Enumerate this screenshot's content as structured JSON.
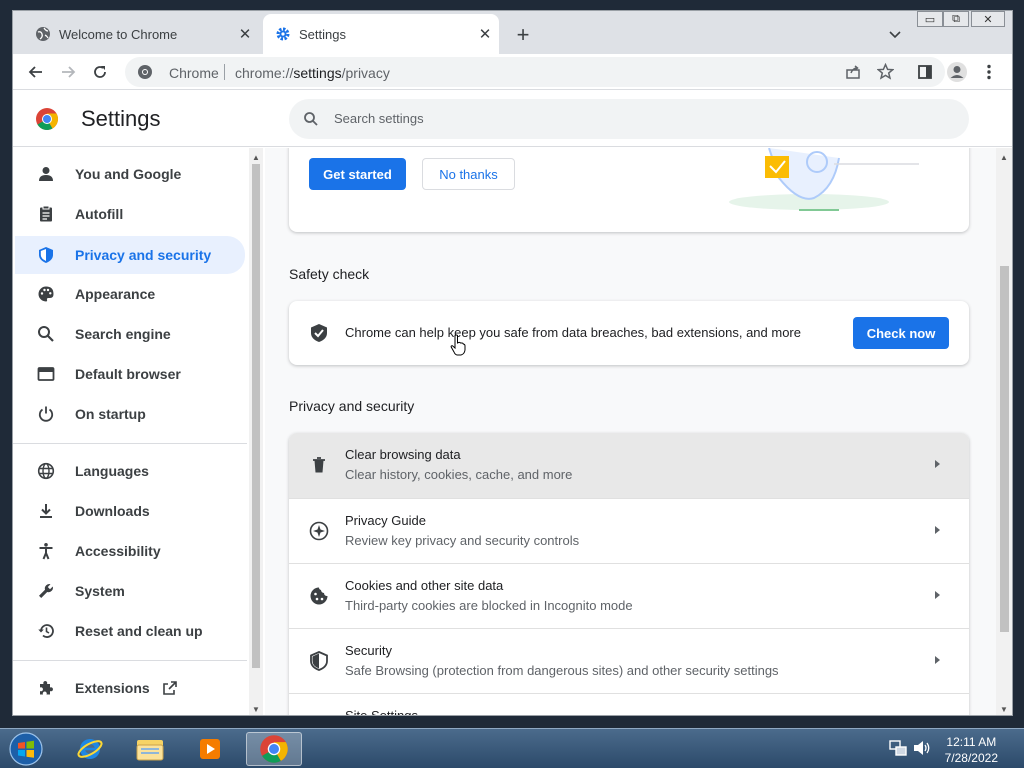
{
  "tabs": [
    {
      "label": "Welcome to Chrome",
      "icon": "globe-icon"
    },
    {
      "label": "Settings",
      "icon": "gear-icon"
    }
  ],
  "toolbar": {
    "site_label": "Chrome",
    "url_prefix": "chrome://",
    "url_host": "settings",
    "url_path": "/privacy"
  },
  "header": {
    "title": "Settings",
    "search_placeholder": "Search settings"
  },
  "sidebar": {
    "items": [
      {
        "label": "You and Google",
        "icon": "person-icon"
      },
      {
        "label": "Autofill",
        "icon": "clipboard-icon"
      },
      {
        "label": "Privacy and security",
        "icon": "shield-icon",
        "selected": true
      },
      {
        "label": "Appearance",
        "icon": "palette-icon"
      },
      {
        "label": "Search engine",
        "icon": "search-icon"
      },
      {
        "label": "Default browser",
        "icon": "browser-icon"
      },
      {
        "label": "On startup",
        "icon": "power-icon"
      },
      {
        "label": "Languages",
        "icon": "globe-icon"
      },
      {
        "label": "Downloads",
        "icon": "download-icon"
      },
      {
        "label": "Accessibility",
        "icon": "accessibility-icon"
      },
      {
        "label": "System",
        "icon": "wrench-icon"
      },
      {
        "label": "Reset and clean up",
        "icon": "restore-icon"
      },
      {
        "label": "Extensions",
        "icon": "puzzle-icon"
      }
    ]
  },
  "promo": {
    "primary": "Get started",
    "secondary": "No thanks"
  },
  "safety_check": {
    "title": "Safety check",
    "text": "Chrome can help keep you safe from data breaches, bad extensions, and more",
    "button": "Check now"
  },
  "privacy": {
    "title": "Privacy and security",
    "rows": [
      {
        "title": "Clear browsing data",
        "subtitle": "Clear history, cookies, cache, and more",
        "icon": "trash-icon"
      },
      {
        "title": "Privacy Guide",
        "subtitle": "Review key privacy and security controls",
        "icon": "compass-icon"
      },
      {
        "title": "Cookies and other site data",
        "subtitle": "Third-party cookies are blocked in Incognito mode",
        "icon": "cookie-icon"
      },
      {
        "title": "Security",
        "subtitle": "Safe Browsing (protection from dangerous sites) and other security settings",
        "icon": "shield-icon"
      },
      {
        "title": "Site Settings",
        "subtitle": "",
        "icon": "sliders-icon"
      }
    ]
  },
  "taskbar": {
    "time": "12:11 AM",
    "date": "7/28/2022"
  },
  "colors": {
    "accent": "#1a73e8",
    "selected_bg": "#e8f0fe",
    "taskbar": "#2c4a6a"
  }
}
